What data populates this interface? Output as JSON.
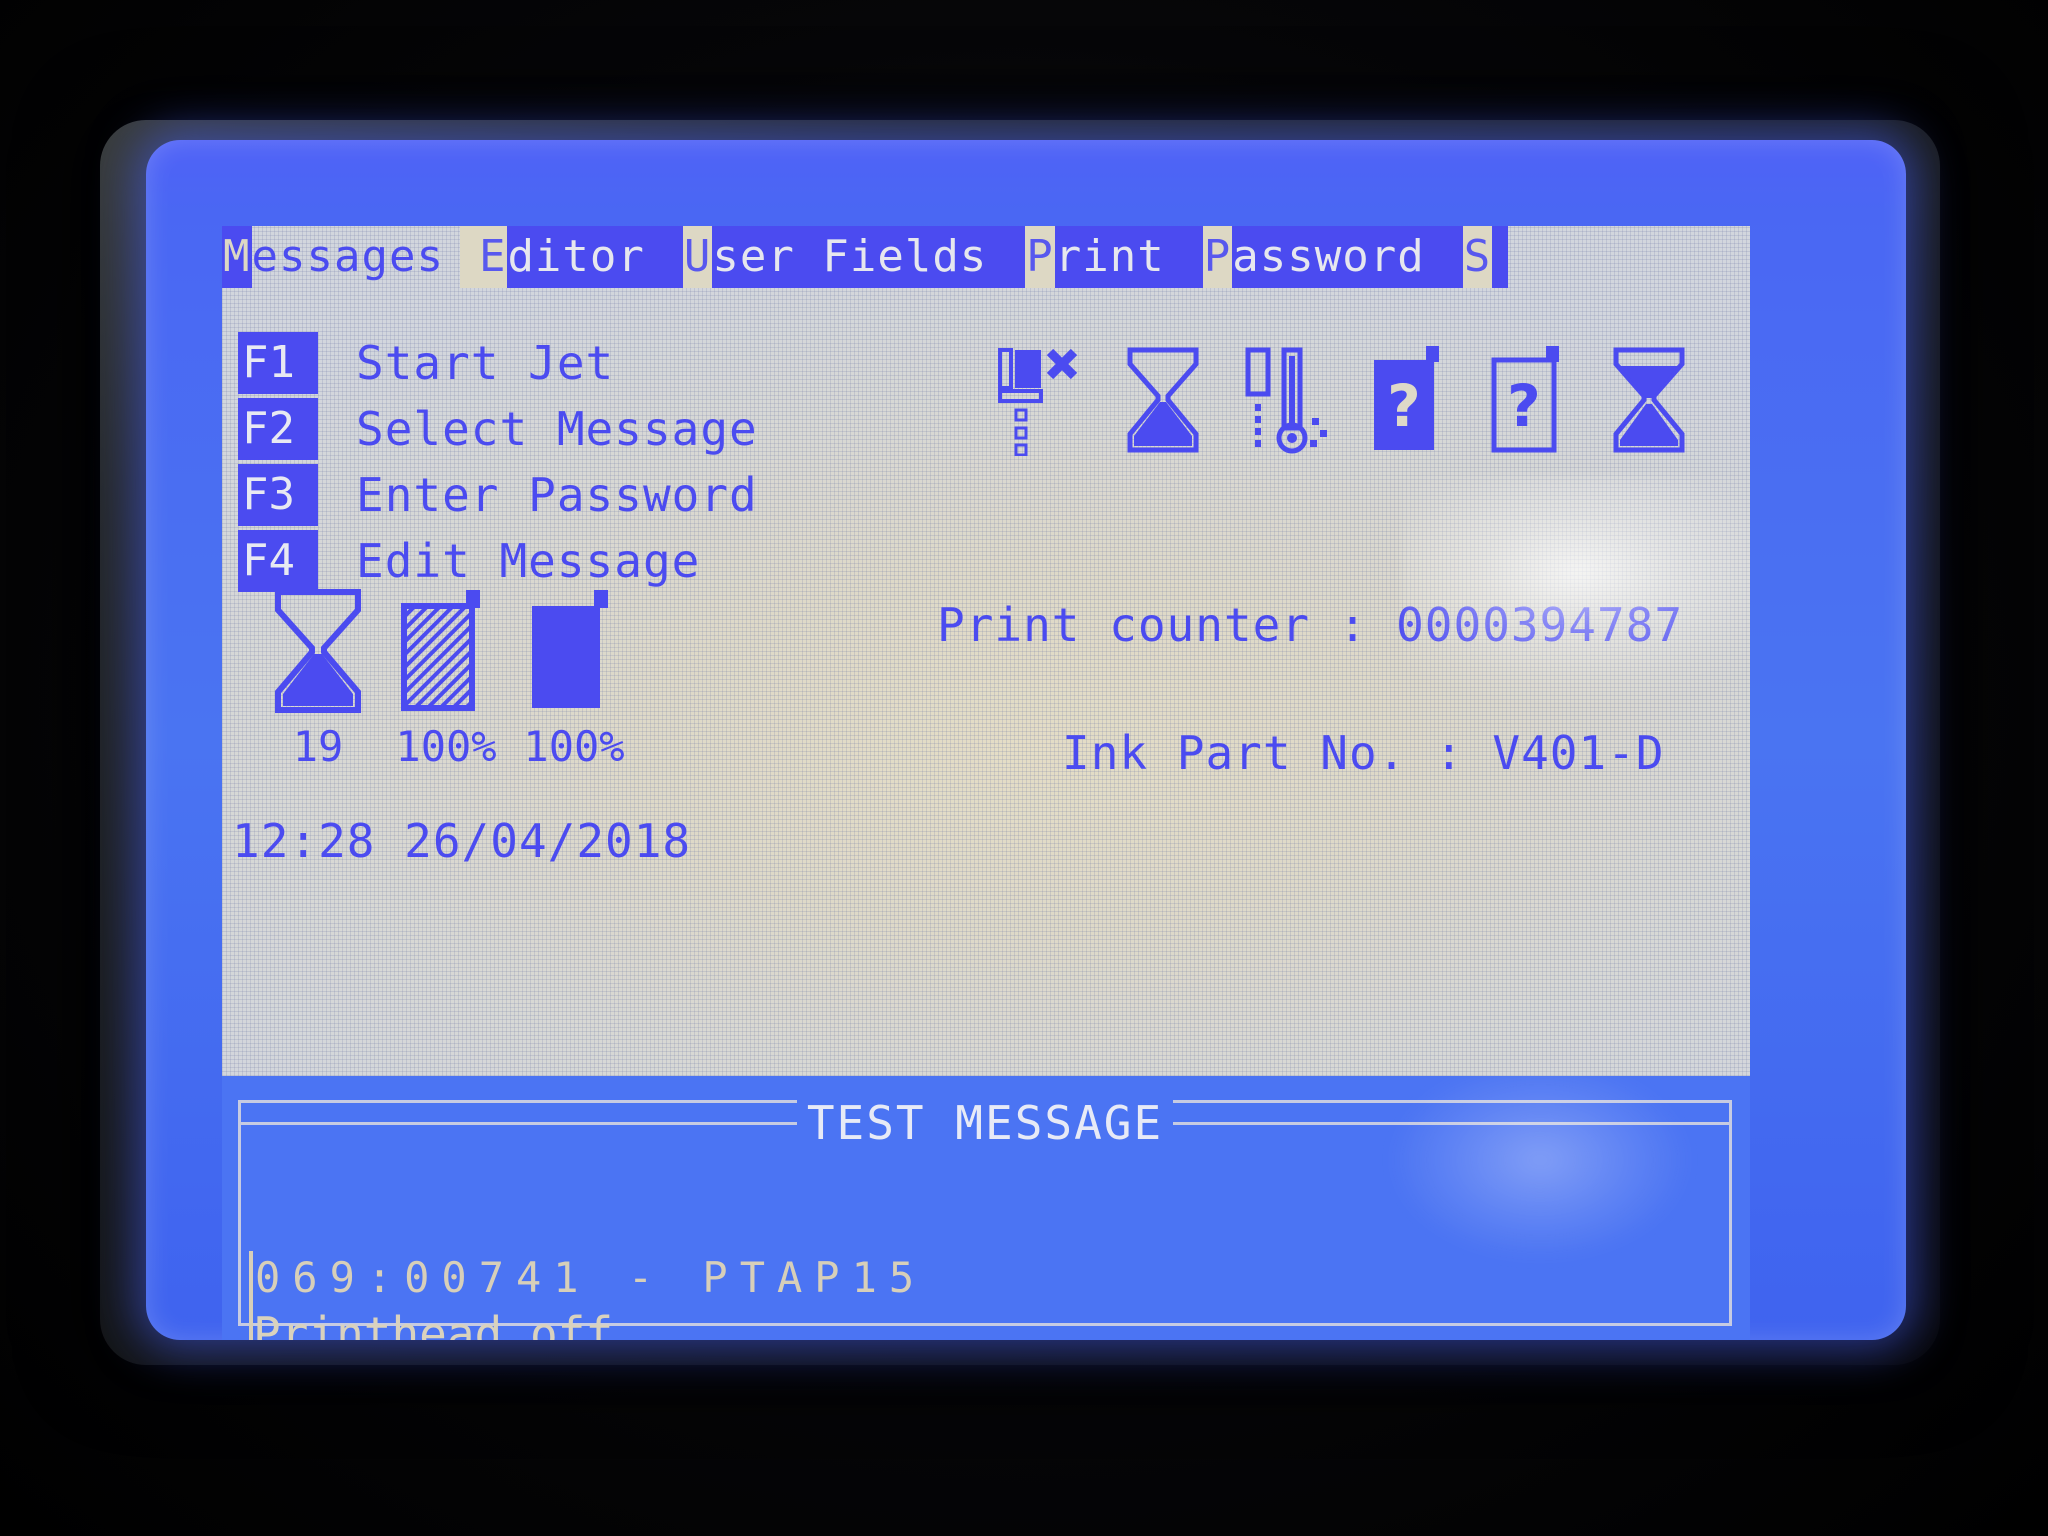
{
  "device": {
    "screen_type": "lcd-control-panel"
  },
  "menubar": {
    "items": [
      {
        "label": "Messages",
        "accel": "M",
        "rest": "essages",
        "state": "active"
      },
      {
        "label": "Editor",
        "accel": "E",
        "rest": "ditor",
        "state": "normal"
      },
      {
        "label": "User Fields",
        "accel": "U",
        "rest": "ser Fields",
        "state": "normal"
      },
      {
        "label": "Print",
        "accel": "P",
        "rest": "rint",
        "state": "normal"
      },
      {
        "label": "Password",
        "accel": "P",
        "rest": "assword",
        "state": "normal"
      },
      {
        "label": "S",
        "accel": "S",
        "rest": "",
        "state": "normal"
      }
    ]
  },
  "function_keys": [
    {
      "key": "F1",
      "label": "Start Jet"
    },
    {
      "key": "F2",
      "label": "Select Message"
    },
    {
      "key": "F3",
      "label": "Enter Password"
    },
    {
      "key": "F4",
      "label": "Edit Message"
    }
  ],
  "status_icons": [
    {
      "name": "printhead-off-icon",
      "caption": ""
    },
    {
      "name": "hourglass-bottom-icon",
      "caption": ""
    },
    {
      "name": "viscometer-icon",
      "caption": ""
    },
    {
      "name": "ink-cartridge-full-question-icon",
      "caption": ""
    },
    {
      "name": "ink-cartridge-empty-question-icon",
      "caption": ""
    },
    {
      "name": "hourglass-top-icon",
      "caption": ""
    }
  ],
  "level_indicators": [
    {
      "name": "hourglass-icon",
      "caption": "19"
    },
    {
      "name": "makeup-cartridge-icon",
      "caption": "100%"
    },
    {
      "name": "ink-cartridge-icon",
      "caption": "100%"
    }
  ],
  "readouts": {
    "print_counter_label": "Print counter : ",
    "print_counter_value": "0000394787",
    "ink_part_label": "Ink Part No. : ",
    "ink_part_value": "V401-D",
    "clock": "12:28 26/04/2018"
  },
  "message_panel": {
    "title": "TEST MESSAGE",
    "line1": "069:00741 - PTAP15",
    "line2": "Printhead off"
  },
  "colors": {
    "lcd_blue": "#4b4bf0",
    "panel_blue": "#4b74f3",
    "screen_cream": "#ded9c8",
    "text_light": "#e6e7ee",
    "bezel_dark": "#17191a"
  }
}
